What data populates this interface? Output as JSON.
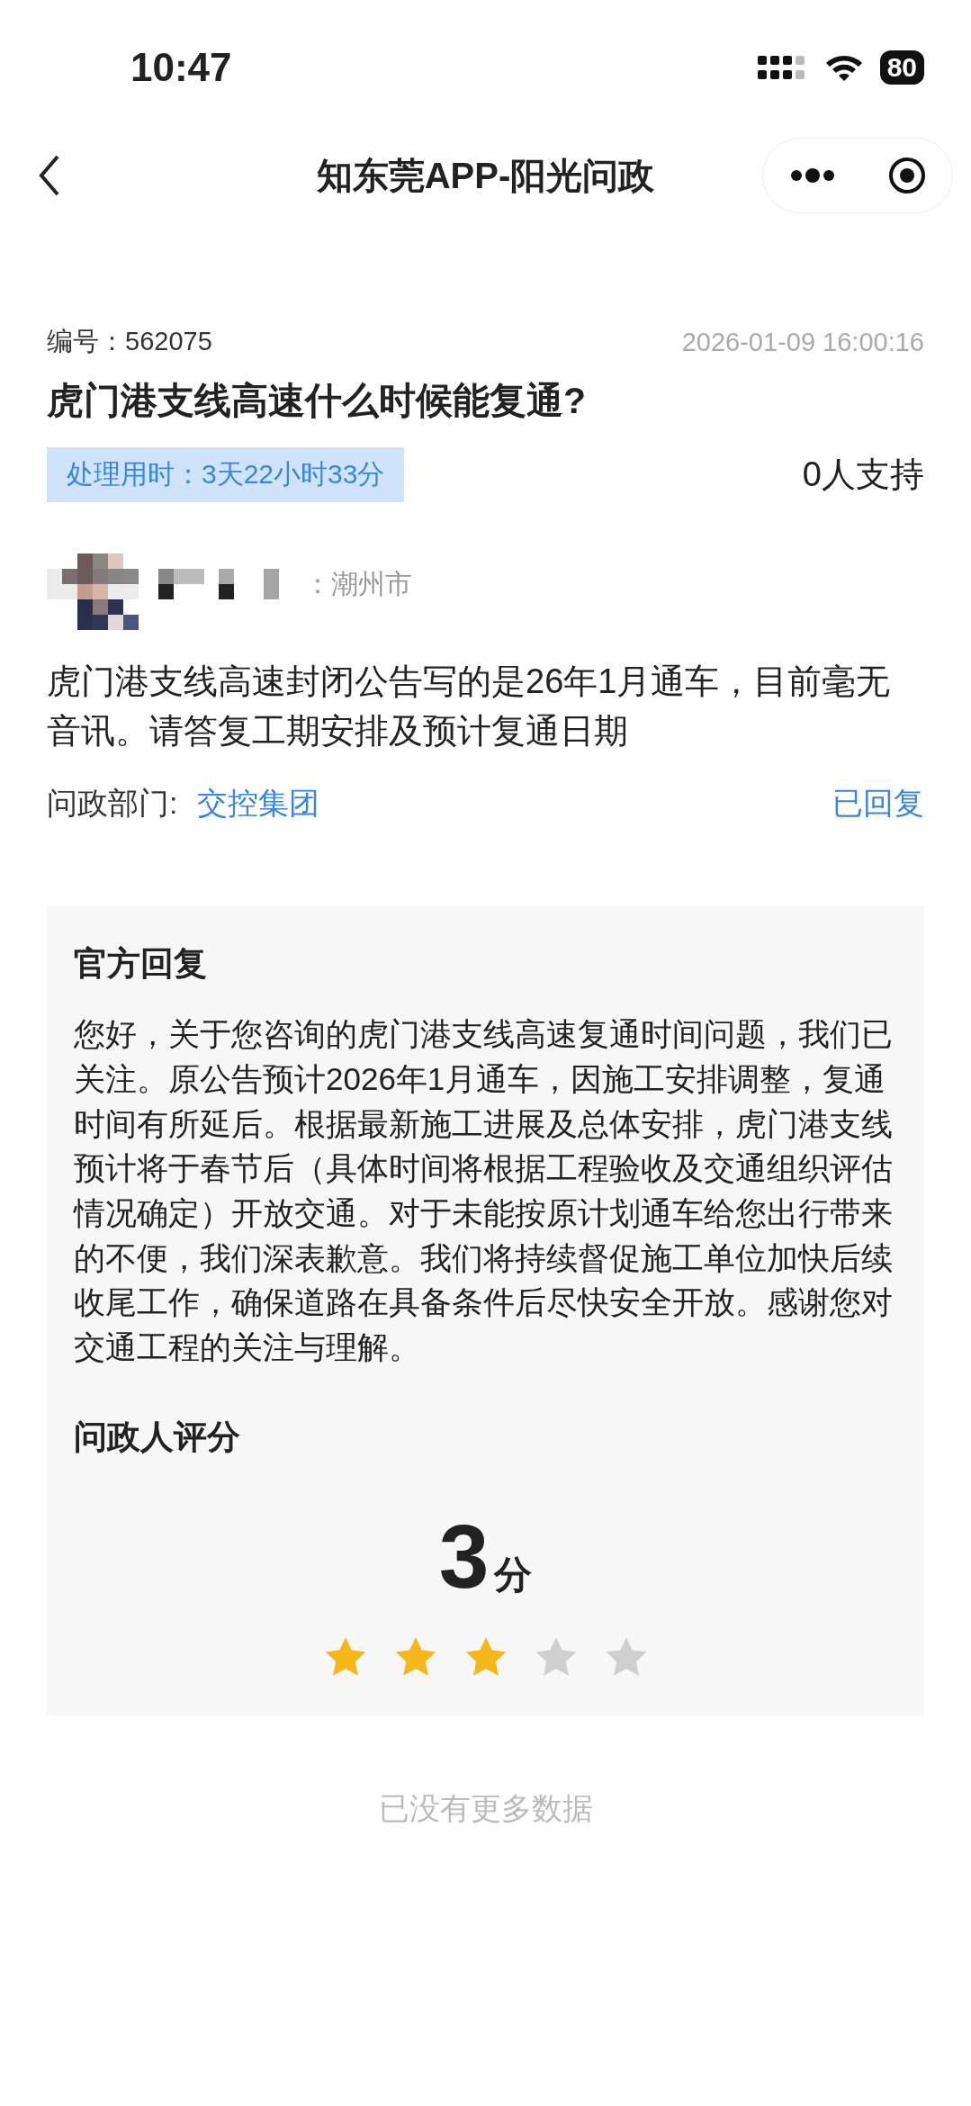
{
  "status_bar": {
    "time": "10:47",
    "battery": "80"
  },
  "nav": {
    "title": "知东莞APP-阳光问政"
  },
  "question": {
    "number_label": "编号：",
    "number": "562075",
    "datetime": "2026-01-09 16:00:16",
    "title": "虎门港支线高速什么时候能复通?",
    "duration": "处理用时：3天22小时33分",
    "support": "0人支持",
    "location": "：潮州市",
    "body": "虎门港支线高速封闭公告写的是26年1月通车，目前毫无音讯。请答复工期安排及预计复通日期",
    "department_label": "问政部门:",
    "department": "交控集团",
    "status": "已回复"
  },
  "reply": {
    "heading": "官方回复",
    "body": "您好，关于您咨询的虎门港支线高速复通时间问题，我们已关注。原公告预计2026年1月通车，因施工安排调整，复通时间有所延后。根据最新施工进展及总体安排，虎门港支线预计将于春节后（具体时间将根据工程验收及交通组织评估情况确定）开放交通。对于未能按原计划通车给您出行带来的不便，我们深表歉意。我们将持续督促施工单位加快后续收尾工作，确保道路在具备条件后尽快安全开放。感谢您对交通工程的关注与理解。"
  },
  "rating": {
    "heading": "问政人评分",
    "score": "3",
    "unit": "分",
    "stars": 3
  },
  "footer": "已没有更多数据"
}
